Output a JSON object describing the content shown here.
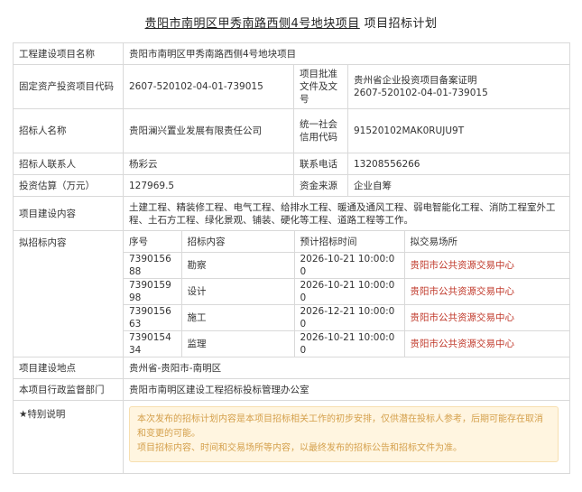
{
  "title": {
    "main": "贵阳市南明区甲秀南路西侧4号地块项目",
    "suffix": "项目招标计划"
  },
  "rows": {
    "project_name": {
      "label": "工程建设项目名称",
      "value": "贵阳市南明区甲秀南路西侧4号地块项目"
    },
    "fixed_asset_code": {
      "label": "固定资产投资项目代码",
      "value": "2607-520102-04-01-739015"
    },
    "approval_doc": {
      "label": "项目批准文件及文号",
      "value_line1": "贵州省企业投资项目备案证明",
      "value_line2": "2607-520102-04-01-739015"
    },
    "tenderer": {
      "label": "招标人名称",
      "value": "贵阳澜兴置业发展有限责任公司"
    },
    "credit_code": {
      "label": "统一社会信用代码",
      "value": "91520102MAK0RUJU9T"
    },
    "contact": {
      "label": "招标人联系人",
      "value": "杨彩云"
    },
    "phone": {
      "label": "联系电话",
      "value": "13208556266"
    },
    "investment": {
      "label": "投资估算（万元）",
      "value": "127969.5"
    },
    "fund_source": {
      "label": "资金来源",
      "value": "企业自筹"
    },
    "content": {
      "label": "项目建设内容",
      "value": "土建工程、精装修工程、电气工程、给排水工程、暖通及通风工程、弱电智能化工程、消防工程室外工程、土石方工程、绿化景观、铺装、硬化等工程、道路工程等工作。"
    },
    "tender_plan": {
      "label": "拟招标内容",
      "headers": [
        "序号",
        "招标内容",
        "预计招标时间",
        "拟交易场所"
      ],
      "items": [
        {
          "no": "739015688",
          "kind": "勘察",
          "time": "2026-10-21 10:00:00",
          "venue": "贵阳市公共资源交易中心"
        },
        {
          "no": "739015998",
          "kind": "设计",
          "time": "2026-10-21 10:00:00",
          "venue": "贵阳市公共资源交易中心"
        },
        {
          "no": "739015663",
          "kind": "施工",
          "time": "2026-12-21 10:00:00",
          "venue": "贵阳市公共资源交易中心"
        },
        {
          "no": "739015434",
          "kind": "监理",
          "time": "2026-10-21 10:00:00",
          "venue": "贵阳市公共资源交易中心"
        }
      ]
    },
    "location": {
      "label": "项目建设地点",
      "value": "贵州省-贵阳市-南明区"
    },
    "supervisor": {
      "label": "本项目行政监督部门",
      "value": "贵阳市南明区建设工程招标投标管理办公室"
    },
    "special": {
      "label": "★特别说明",
      "line1": "本次发布的招标计划内容是本项目招标相关工作的初步安排，仅供潜在投标人参考，后期可能存在取消和变更的可能。",
      "line2": "项目招标内容、时间和交易场所等内容，以最终发布的招标公告和招标文件为准。"
    }
  },
  "colors": {
    "border": "#d9d9d9",
    "venue_text": "#c0392b",
    "notice_bg": "#fff5e0",
    "notice_text": "#d4a04c"
  }
}
